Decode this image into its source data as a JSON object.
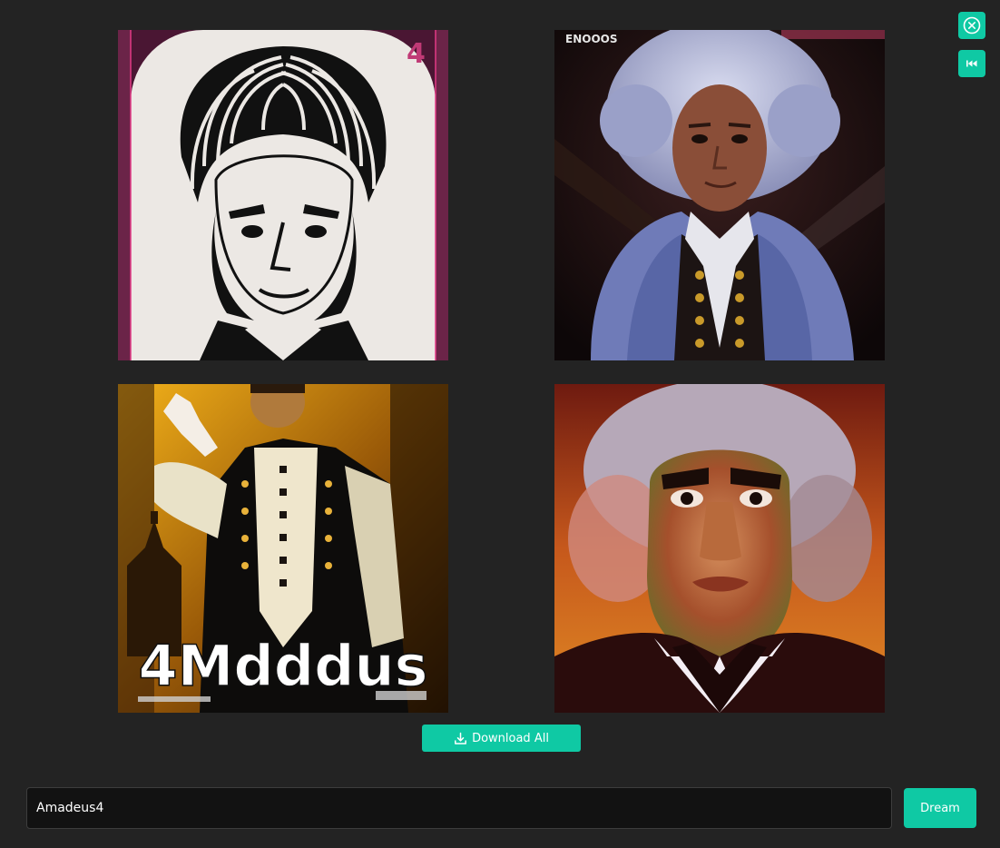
{
  "theme": {
    "background": "#232323",
    "accent": "#0fc9a4",
    "input_background": "#121212"
  },
  "toolbar": {
    "close_icon": "close-circle-icon",
    "rewind_icon": "skip-back-icon"
  },
  "gallery": {
    "images": [
      {
        "name": "generated-image-1",
        "poster_corner_text": "4"
      },
      {
        "name": "generated-image-2",
        "poster_corner_text": "ENOOOS"
      },
      {
        "name": "generated-image-3",
        "poster_title": "4Mdddus"
      },
      {
        "name": "generated-image-4"
      }
    ]
  },
  "actions": {
    "download_label": "Download All",
    "download_icon": "download-icon",
    "dream_label": "Dream"
  },
  "prompt": {
    "value": "Amadeus4",
    "placeholder": ""
  }
}
